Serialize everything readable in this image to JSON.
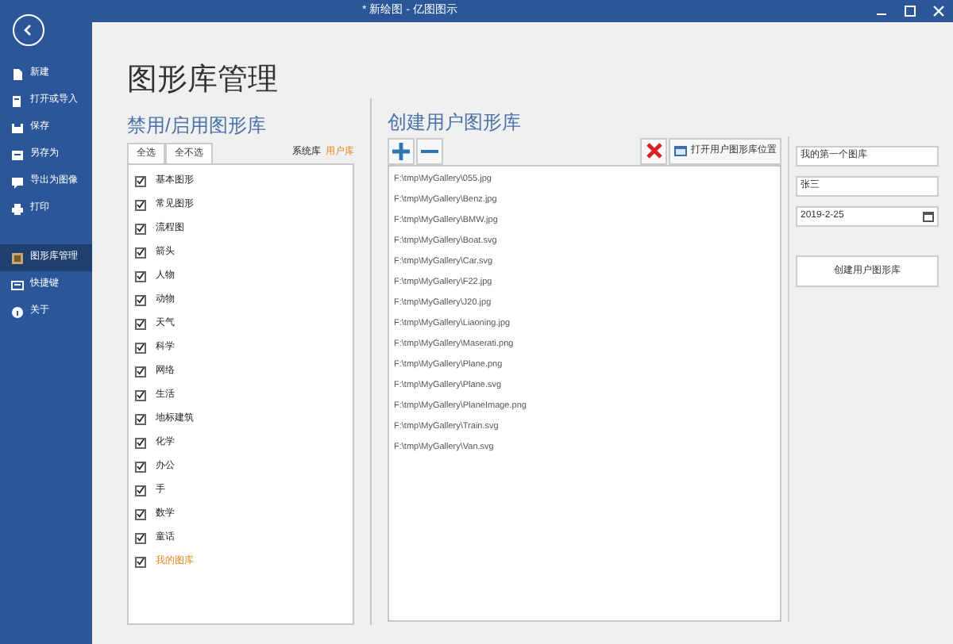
{
  "window": {
    "title": "* 新绘图 - 亿图图示"
  },
  "sidebar": {
    "items": [
      {
        "label": "新建",
        "selected": false
      },
      {
        "label": "打开或导入",
        "selected": false
      },
      {
        "label": "保存",
        "selected": false
      },
      {
        "label": "另存为",
        "selected": false
      },
      {
        "label": "导出为图像",
        "selected": false
      },
      {
        "label": "打印",
        "selected": false
      },
      {
        "label": "图形库管理",
        "selected": true
      },
      {
        "label": "快捷键",
        "selected": false
      },
      {
        "label": "关于",
        "selected": false
      }
    ]
  },
  "page_title": "图形库管理",
  "toggle_panel": {
    "heading": "禁用/启用图形库",
    "buttons": [
      "全选",
      "全不选"
    ],
    "legend": [
      {
        "label": "系统库",
        "kind": "system"
      },
      {
        "label": "用户库",
        "kind": "user"
      }
    ],
    "libraries": [
      {
        "label": "基本图形",
        "checked": true,
        "kind": "system"
      },
      {
        "label": "常见图形",
        "checked": true,
        "kind": "system"
      },
      {
        "label": "流程图",
        "checked": true,
        "kind": "system"
      },
      {
        "label": "箭头",
        "checked": true,
        "kind": "system"
      },
      {
        "label": "人物",
        "checked": true,
        "kind": "system"
      },
      {
        "label": "动物",
        "checked": true,
        "kind": "system"
      },
      {
        "label": "天气",
        "checked": true,
        "kind": "system"
      },
      {
        "label": "科学",
        "checked": true,
        "kind": "system"
      },
      {
        "label": "网络",
        "checked": true,
        "kind": "system"
      },
      {
        "label": "生活",
        "checked": true,
        "kind": "system"
      },
      {
        "label": "地标建筑",
        "checked": true,
        "kind": "system"
      },
      {
        "label": "化学",
        "checked": true,
        "kind": "system"
      },
      {
        "label": "办公",
        "checked": true,
        "kind": "system"
      },
      {
        "label": "手",
        "checked": true,
        "kind": "system"
      },
      {
        "label": "数学",
        "checked": true,
        "kind": "system"
      },
      {
        "label": "童话",
        "checked": true,
        "kind": "system"
      },
      {
        "label": "我的图库",
        "checked": true,
        "kind": "user"
      }
    ]
  },
  "create_panel": {
    "heading": "创建用户图形库",
    "open_location_button": "打开用户图形库位置",
    "files": [
      "F:\\tmp\\MyGallery\\055.jpg",
      "F:\\tmp\\MyGallery\\Benz.jpg",
      "F:\\tmp\\MyGallery\\BMW.jpg",
      "F:\\tmp\\MyGallery\\Boat.svg",
      "F:\\tmp\\MyGallery\\Car.svg",
      "F:\\tmp\\MyGallery\\F22.jpg",
      "F:\\tmp\\MyGallery\\J20.jpg",
      "F:\\tmp\\MyGallery\\Liaoning.jpg",
      "F:\\tmp\\MyGallery\\Maserati.png",
      "F:\\tmp\\MyGallery\\Plane.png",
      "F:\\tmp\\MyGallery\\Plane.svg",
      "F:\\tmp\\MyGallery\\PlaneImage.png",
      "F:\\tmp\\MyGallery\\Train.svg",
      "F:\\tmp\\MyGallery\\Van.svg"
    ],
    "name_field": "我的第一个图库",
    "author_field": "张三",
    "date_field": "2019-2-25",
    "create_button": "创建用户图形库"
  }
}
